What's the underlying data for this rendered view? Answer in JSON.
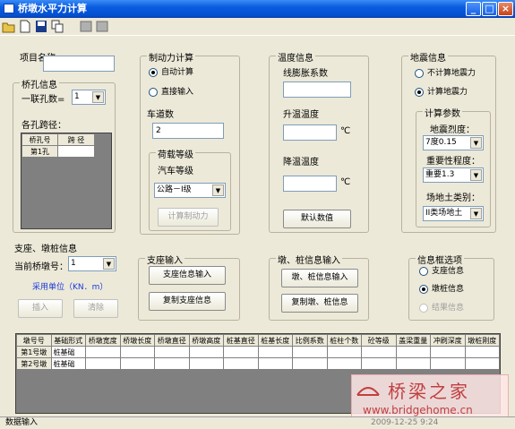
{
  "window": {
    "title": "桥墩水平力计算"
  },
  "left": {
    "project_name_label": "项目名称",
    "project_name_value": "",
    "bridge_group_title": "桥孔信息",
    "span_count_label": "一联孔数=",
    "span_count_value": "1",
    "span_length_label": "各孔跨径：",
    "span_table": {
      "headers": [
        "桥孔号",
        "跨 径"
      ],
      "rows": [
        [
          "第1孔",
          ""
        ]
      ]
    }
  },
  "braking": {
    "group_title": "制动力计算",
    "auto_label": "自动计算",
    "manual_label": "直接输入",
    "lanes_label": "车道数",
    "lanes_value": "2",
    "load_group_title": "荷载等级",
    "vehicle_label": "汽车等级",
    "vehicle_value": "公路－I级",
    "calc_button": "计算制动力"
  },
  "temperature": {
    "group_title": "温度信息",
    "expansion_label": "线膨胀系数",
    "rise_label": "升温温度",
    "drop_label": "降温温度",
    "unit": "℃",
    "default_button": "默认数值"
  },
  "seismic": {
    "group_title": "地震信息",
    "no_calc_label": "不计算地震力",
    "calc_label": "计算地震力",
    "params_title": "计算参数",
    "intensity_label": "地震烈度：",
    "intensity_value": "7度0.15",
    "importance_label": "重要性程度：",
    "importance_value": "重要1.3",
    "site_label": "场地土类别：",
    "site_value": "II类场地土"
  },
  "pier": {
    "group_title": "支座、墩桩信息",
    "current_pier_label": "当前桥墩号：",
    "current_pier_value": "1",
    "unit_label": "采用单位（KN．m）",
    "insert_button": "插入",
    "delete_button": "清除"
  },
  "bearing": {
    "group_title": "支座输入",
    "input_button": "支座信息输入",
    "copy_button": "复制支座信息"
  },
  "pier_pile": {
    "group_title": "墩、桩信息输入",
    "input_button": "墩、桩信息输入",
    "copy_button": "复制墩、桩信息"
  },
  "info_options": {
    "group_title": "信息框选项",
    "bearing_label": "支座信息",
    "pier_pile_label": "墩桩信息",
    "result_label": "结果信息"
  },
  "main_table": {
    "headers": [
      "墩号号",
      "基础形式",
      "桥墩宽度",
      "桥墩长度",
      "桥墩直径",
      "桥墩高度",
      "桩基直径",
      "桩基长度",
      "比例系数",
      "桩柱个数",
      "砼等级",
      "盖梁重量",
      "冲刷深度",
      "墩桩刚度"
    ],
    "rows": [
      [
        "第1号墩",
        "桩基础",
        "",
        "",
        "",
        "",
        "",
        "",
        "",
        "",
        "",
        "",
        "",
        ""
      ],
      [
        "第2号墩",
        "桩基础",
        "",
        "",
        "",
        "",
        "",
        "",
        "",
        "",
        "",
        "",
        "",
        ""
      ]
    ]
  },
  "status": {
    "left": "数据输入",
    "right": "2009-12-25 9:24"
  },
  "watermark": {
    "cn": "桥梁之家",
    "url": "www.bridgehome.cn"
  }
}
